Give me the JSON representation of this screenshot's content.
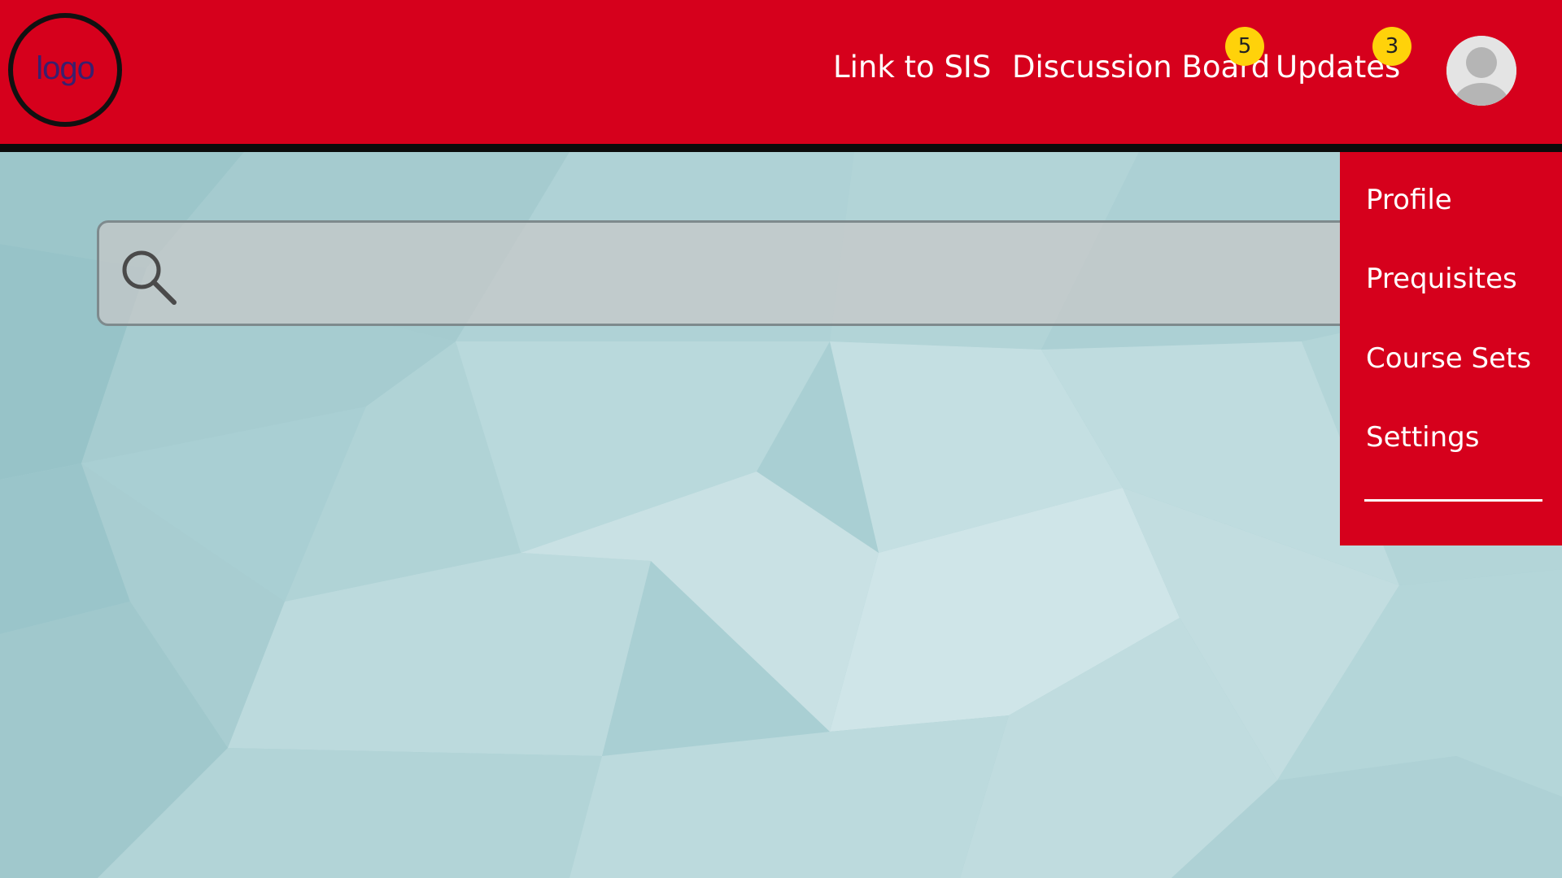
{
  "colors": {
    "brand_red": "#d6001c",
    "badge_yellow": "#ffd20a",
    "header_border": "#0b0b0b",
    "background_teal": "#a9cfd3"
  },
  "header": {
    "logo_text": "logo",
    "nav": [
      {
        "label": "Link to SIS"
      },
      {
        "label": "Discussion Board",
        "badge": "5"
      },
      {
        "label": "Updates",
        "badge": "3"
      }
    ],
    "avatar_icon": "user-avatar-icon"
  },
  "search": {
    "icon": "search-icon",
    "placeholder": "",
    "value": ""
  },
  "user_menu": {
    "items": [
      {
        "label": "Profile"
      },
      {
        "label": "Prequisites"
      },
      {
        "label": "Course Sets"
      },
      {
        "label": "Settings"
      }
    ]
  }
}
